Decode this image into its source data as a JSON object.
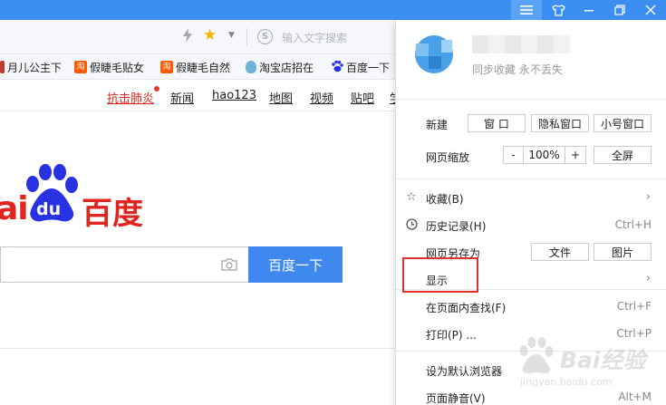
{
  "colors": {
    "titlebar": "#3c8ff0",
    "accent_blue": "#3e88f0",
    "baidu_red": "#e02420",
    "highlight_red": "#e0302b"
  },
  "toolbar": {
    "search_placeholder": "输入文字搜索",
    "search_engine_icon": "S"
  },
  "bookmarks": [
    {
      "label": "月儿公主下"
    },
    {
      "label": "假睫毛贴女",
      "icon_text": "淘"
    },
    {
      "label": "假睫毛自然",
      "icon_text": "淘"
    },
    {
      "label": "淘宝店招在"
    },
    {
      "label": "百度一下"
    }
  ],
  "baidu": {
    "nav": [
      "抗击肺炎",
      "新闻",
      "hao123",
      "地图",
      "视频",
      "贴吧",
      "学"
    ],
    "logo_latin": "ai",
    "logo_du": "du",
    "logo_cn": "百度",
    "search_button": "百度一下"
  },
  "menu": {
    "sync_text": "同步收藏 永不丢失",
    "new_label": "新建",
    "new_buttons": [
      "窗 口",
      "隐私窗口",
      "小号窗口"
    ],
    "zoom_label": "网页缩放",
    "zoom_minus": "-",
    "zoom_value": "100%",
    "zoom_plus": "+",
    "fullscreen": "全屏",
    "items": [
      {
        "label": "收藏(B)",
        "shortcut": "",
        "has_sub": true
      },
      {
        "label": "历史记录(H)",
        "shortcut": "Ctrl+H"
      },
      {
        "label": "网页另存为",
        "buttons": [
          "文件",
          "图片"
        ]
      },
      {
        "label": "显示",
        "has_sub": true
      },
      {
        "label": "在页面内查找(F)",
        "shortcut": "Ctrl+F"
      },
      {
        "label": "打印(P) ...",
        "shortcut": "Ctrl+P"
      },
      {
        "label": "设为默认浏览器"
      },
      {
        "label": "页面静音(V)",
        "shortcut": "Alt+M"
      }
    ]
  },
  "watermark": {
    "text": "Bai经验",
    "url": "jingyan.baidu.com"
  }
}
